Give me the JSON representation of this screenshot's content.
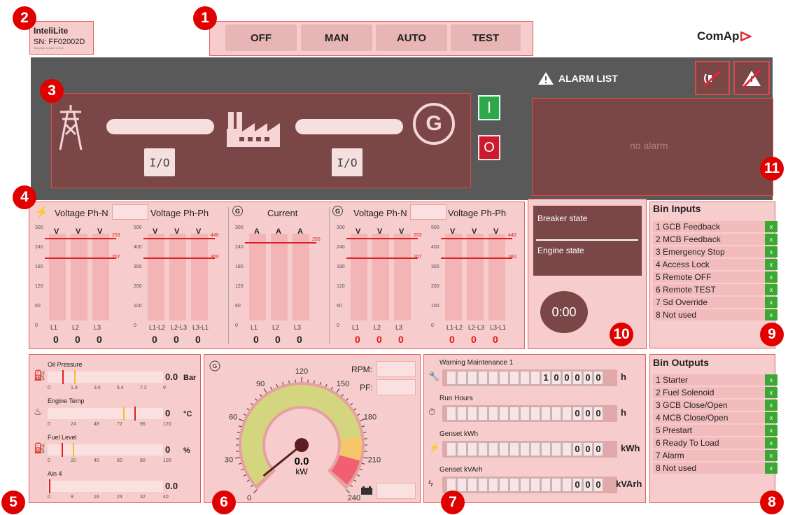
{
  "device": {
    "name": "InteliLite",
    "sn": "SN: FF02002D",
    "template": "Template version 1.0.00"
  },
  "brand": "ComAp",
  "modes": [
    "OFF",
    "MAN",
    "AUTO",
    "TEST"
  ],
  "markers": [
    "1",
    "2",
    "3",
    "4",
    "5",
    "6",
    "7",
    "8",
    "9",
    "10",
    "11"
  ],
  "alarm": {
    "title": "ALARM LIST",
    "empty": "no alarm"
  },
  "scheme": {
    "io1": "I/O",
    "io2": "I/O",
    "start": "I",
    "stop": "O",
    "gen": "G"
  },
  "measure": {
    "mains_vpn": "Voltage Ph-N",
    "mains_vpp": "Voltage Ph-Ph",
    "current": "Current",
    "gen_vpn": "Voltage Ph-N",
    "gen_vpp": "Voltage Ph-Ph",
    "unit_v": "V",
    "unit_a": "A",
    "ticks_vpn": [
      "300",
      "240",
      "180",
      "120",
      "60",
      "0"
    ],
    "ticks_vpp": [
      "500",
      "400",
      "300",
      "200",
      "100",
      "0"
    ],
    "phase_n": [
      "L1",
      "L2",
      "L3"
    ],
    "phase_pp": [
      "L1-L2",
      "L2-L3",
      "L3-L1"
    ],
    "lim_vpn_hi": "253",
    "lim_vpn_lo": "207",
    "lim_vpp_hi": "440",
    "lim_vpp_lo": "360",
    "lim_cur": "250",
    "values": [
      "0",
      "0",
      "0"
    ]
  },
  "state": {
    "breaker": "Breaker state",
    "engine": "Engine state",
    "timer": "0:00"
  },
  "bin_inputs": {
    "title": "Bin Inputs",
    "items": [
      "1 GCB Feedback",
      "2 MCB Feedback",
      "3 Emergency Stop",
      "4 Access Lock",
      "5 Remote OFF",
      "6 Remote TEST",
      "7 Sd Override",
      "8 Not used"
    ],
    "mark": "x"
  },
  "bin_outputs": {
    "title": "Bin Outputs",
    "items": [
      "1 Starter",
      "2 Fuel Solenoid",
      "3 GCB Close/Open",
      "4 MCB Close/Open",
      "5 Prestart",
      "6 Ready To Load",
      "7 Alarm",
      "8 Not used"
    ],
    "mark": "x"
  },
  "analog": [
    {
      "name": "Oil Pressure",
      "value": "0.0",
      "unit": "Bar",
      "ticks": [
        "0",
        "1.8",
        "3.6",
        "5.4",
        "7.2",
        "9"
      ]
    },
    {
      "name": "Engine Temp",
      "value": "0",
      "unit": "°C",
      "ticks": [
        "0",
        "24",
        "48",
        "72",
        "96",
        "120"
      ]
    },
    {
      "name": "Fuel Level",
      "value": "0",
      "unit": "%",
      "ticks": [
        "0",
        "20",
        "40",
        "60",
        "80",
        "100"
      ]
    },
    {
      "name": "Ain 4",
      "value": "0.0",
      "unit": "",
      "ticks": [
        "0",
        "8",
        "16",
        "24",
        "32",
        "40"
      ]
    }
  ],
  "gauge": {
    "ticks": [
      "0",
      "30",
      "60",
      "90",
      "120",
      "150",
      "180",
      "210",
      "240"
    ],
    "value": "0.0",
    "unit": "kW",
    "rpm": "RPM:",
    "pf": "PF:"
  },
  "counters": [
    {
      "name": "Warning Maintenance 1",
      "digits": [
        "1",
        "0",
        "0",
        "0",
        "0",
        "0"
      ],
      "unit": "h"
    },
    {
      "name": "Run Hours",
      "digits": [
        "0",
        "0",
        "0"
      ],
      "unit": "h"
    },
    {
      "name": "Genset kWh",
      "digits": [
        "0",
        "0",
        "0"
      ],
      "unit": "kWh"
    },
    {
      "name": "Genset kVArh",
      "digits": [
        "0",
        "0",
        "0"
      ],
      "unit": "kVArh"
    }
  ]
}
